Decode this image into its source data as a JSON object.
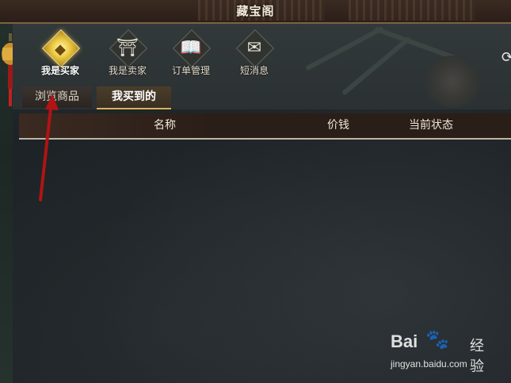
{
  "window": {
    "title": "藏宝阁"
  },
  "nav": [
    {
      "label": "我是买家",
      "icon": "coin-icon",
      "glyph": "◆",
      "active": true
    },
    {
      "label": "我是卖家",
      "icon": "market-stall-icon",
      "glyph": "⛩",
      "active": false
    },
    {
      "label": "订单管理",
      "icon": "ledger-book-icon",
      "glyph": "📖",
      "active": false
    },
    {
      "label": "短消息",
      "icon": "envelope-icon",
      "glyph": "✉",
      "active": false
    }
  ],
  "tabs": [
    {
      "label": "浏览商品",
      "active": false
    },
    {
      "label": "我买到的",
      "active": true
    }
  ],
  "table": {
    "columns": [
      "名称",
      "价钱",
      "当前状态"
    ],
    "rows": []
  },
  "watermark": {
    "brand": "Bai",
    "brand_suffix": "经验",
    "url": "jingyan.baidu.com"
  },
  "colors": {
    "accent_gold": "#d6b25a",
    "arrow_red": "#b01414",
    "header_brown": "#3b2a21"
  }
}
